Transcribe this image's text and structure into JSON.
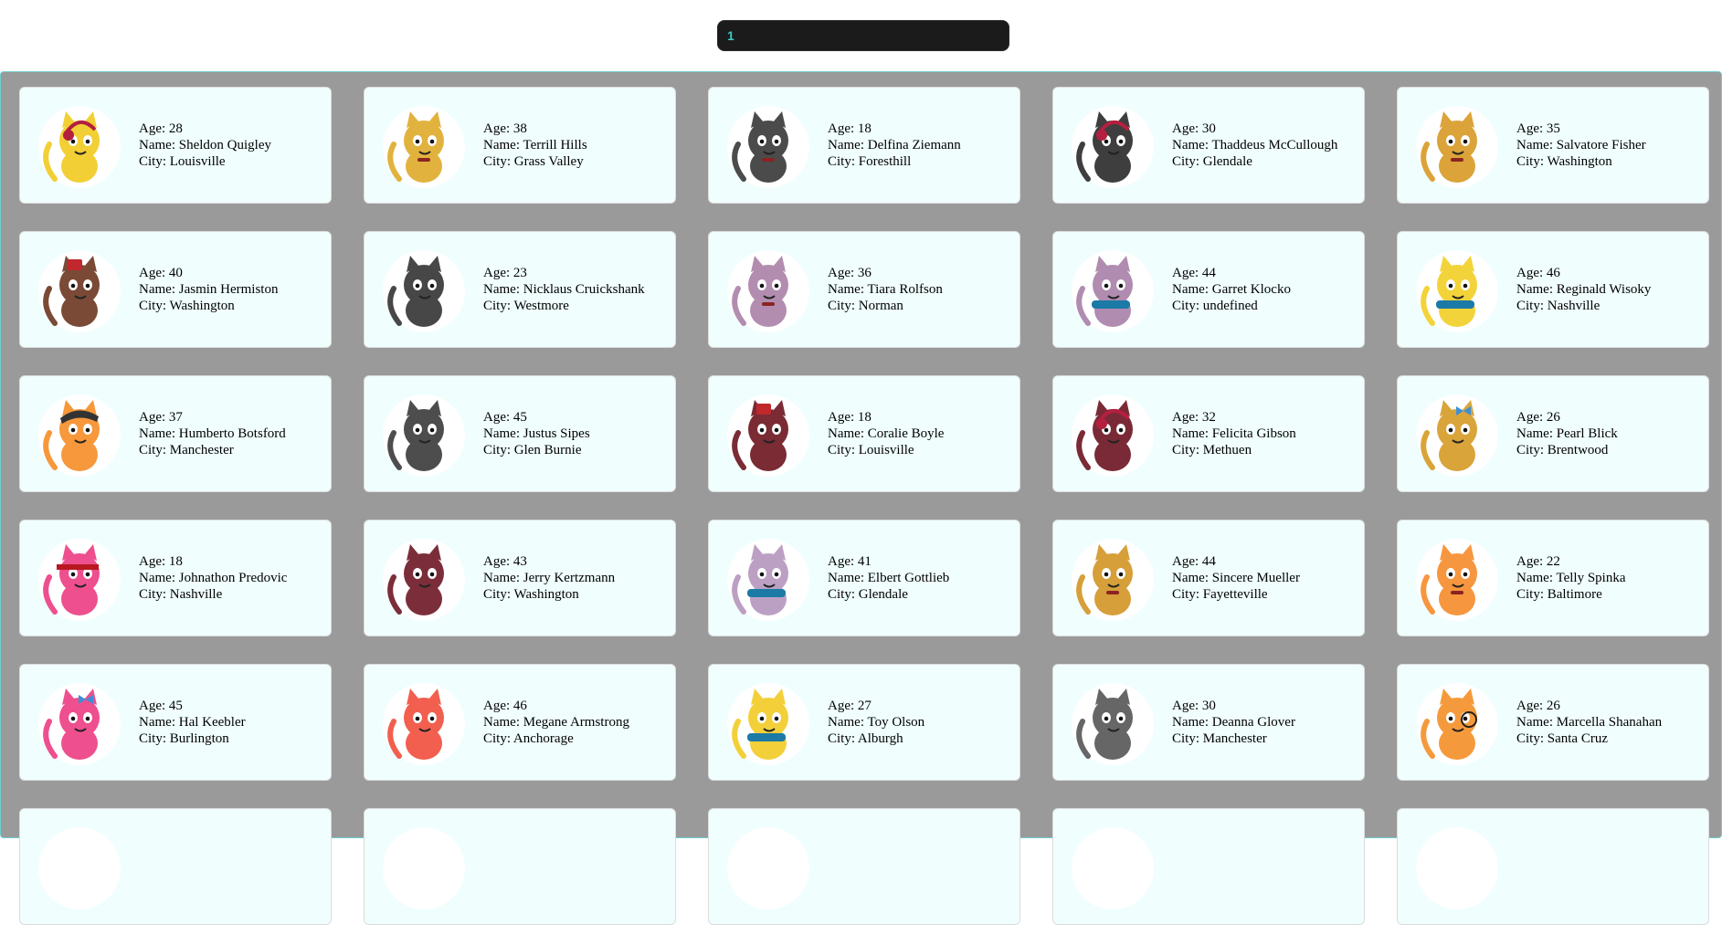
{
  "search": {
    "value": "1"
  },
  "labels": {
    "age": "Age: ",
    "name": "Name: ",
    "city": "City: "
  },
  "cats": [
    {
      "age": 28,
      "name": "Sheldon Quigley",
      "city": "Louisville",
      "fur": "#f2cf34",
      "accessory": "headphones-icon"
    },
    {
      "age": 38,
      "name": "Terrill Hills",
      "city": "Grass Valley",
      "fur": "#e1b23e",
      "accessory": "collar-icon"
    },
    {
      "age": 18,
      "name": "Delfina Ziemann",
      "city": "Foresthill",
      "fur": "#4b4b4b",
      "accessory": "collar-icon"
    },
    {
      "age": 30,
      "name": "Thaddeus McCullough",
      "city": "Glendale",
      "fur": "#3e3e3e",
      "accessory": "headphones-icon"
    },
    {
      "age": 35,
      "name": "Salvatore Fisher",
      "city": "Washington",
      "fur": "#dba33a",
      "accessory": "collar-icon"
    },
    {
      "age": 40,
      "name": "Jasmin Hermiston",
      "city": "Washington",
      "fur": "#7a4a36",
      "accessory": "fez-hat-icon"
    },
    {
      "age": 23,
      "name": "Nicklaus Cruickshank",
      "city": "Westmore",
      "fur": "#474747",
      "accessory": "none"
    },
    {
      "age": 36,
      "name": "Tiara Rolfson",
      "city": "Norman",
      "fur": "#b38db0",
      "accessory": "collar-icon"
    },
    {
      "age": 44,
      "name": "Garret Klocko",
      "city": "undefined",
      "fur": "#b08cb0",
      "accessory": "scarf-icon"
    },
    {
      "age": 46,
      "name": "Reginald Wisoky",
      "city": "Nashville",
      "fur": "#f3d33a",
      "accessory": "scarf-icon"
    },
    {
      "age": 37,
      "name": "Humberto Botsford",
      "city": "Manchester",
      "fur": "#f6983b",
      "accessory": "bandana-icon"
    },
    {
      "age": 45,
      "name": "Justus Sipes",
      "city": "Glen Burnie",
      "fur": "#4d4d4d",
      "accessory": "none"
    },
    {
      "age": 18,
      "name": "Coralie Boyle",
      "city": "Louisville",
      "fur": "#7a2b34",
      "accessory": "fez-hat-icon"
    },
    {
      "age": 32,
      "name": "Felicita Gibson",
      "city": "Methuen",
      "fur": "#7a2a36",
      "accessory": "headphones-icon"
    },
    {
      "age": 26,
      "name": "Pearl Blick",
      "city": "Brentwood",
      "fur": "#d9a43a",
      "accessory": "bow-icon"
    },
    {
      "age": 18,
      "name": "Johnathon Predovic",
      "city": "Nashville",
      "fur": "#ee4f8f",
      "accessory": "headband-icon"
    },
    {
      "age": 43,
      "name": "Jerry Kertzmann",
      "city": "Washington",
      "fur": "#7b2e3a",
      "accessory": "none"
    },
    {
      "age": 41,
      "name": "Elbert Gottlieb",
      "city": "Glendale",
      "fur": "#bca0c4",
      "accessory": "scarf-icon"
    },
    {
      "age": 44,
      "name": "Sincere Mueller",
      "city": "Fayetteville",
      "fur": "#d69f3a",
      "accessory": "collar-icon"
    },
    {
      "age": 22,
      "name": "Telly Spinka",
      "city": "Baltimore",
      "fur": "#f6963f",
      "accessory": "collar-icon"
    },
    {
      "age": 45,
      "name": "Hal Keebler",
      "city": "Burlington",
      "fur": "#ee4f8f",
      "accessory": "bow-icon"
    },
    {
      "age": 46,
      "name": "Megane Armstrong",
      "city": "Anchorage",
      "fur": "#f25f4f",
      "accessory": "none"
    },
    {
      "age": 27,
      "name": "Toy Olson",
      "city": "Alburgh",
      "fur": "#f3d03a",
      "accessory": "scarf-icon"
    },
    {
      "age": 30,
      "name": "Deanna Glover",
      "city": "Manchester",
      "fur": "#666666",
      "accessory": "none"
    },
    {
      "age": 26,
      "name": "Marcella Shanahan",
      "city": "Santa Cruz",
      "fur": "#f59a3c",
      "accessory": "monocle-icon"
    },
    {
      "age": null,
      "name": "",
      "city": "",
      "fur": "#ffffff",
      "accessory": "none"
    },
    {
      "age": null,
      "name": "",
      "city": "",
      "fur": "#ffffff",
      "accessory": "none"
    },
    {
      "age": null,
      "name": "",
      "city": "",
      "fur": "#ffffff",
      "accessory": "none"
    },
    {
      "age": null,
      "name": "",
      "city": "",
      "fur": "#ffffff",
      "accessory": "none"
    },
    {
      "age": null,
      "name": "",
      "city": "",
      "fur": "#ffffff",
      "accessory": "none"
    }
  ]
}
